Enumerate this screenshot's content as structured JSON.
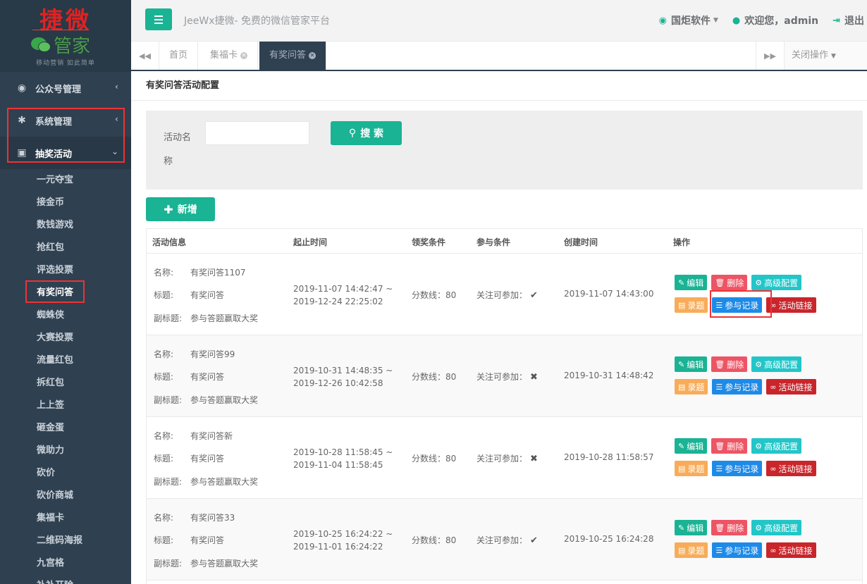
{
  "logo": {
    "main": "捷微",
    "sub": "管家",
    "slogan": "移动营销 如此简单"
  },
  "sidebar": {
    "groups": [
      {
        "label": "公众号管理"
      },
      {
        "label": "系统管理"
      },
      {
        "label": "抽奖活动"
      }
    ],
    "sub_items": [
      "一元夺宝",
      "接金币",
      "数钱游戏",
      "抢红包",
      "评选投票",
      "有奖问答",
      "蜘蛛侠",
      "大赛投票",
      "流量红包",
      "拆红包",
      "上上签",
      "砸金蛋",
      "微助力",
      "砍价",
      "砍价商城",
      "集福卡",
      "二维码海报",
      "九宫格",
      "补补开除"
    ]
  },
  "topbar": {
    "brand": "JeeWx捷微- 免费的微信管家平台",
    "software": "国炬软件",
    "welcome": "欢迎您，admin",
    "logout": "退出"
  },
  "tabs": {
    "items": [
      "首页",
      "集福卡",
      "有奖问答"
    ],
    "close_ops": "关闭操作"
  },
  "panel": {
    "title": "有奖问答活动配置"
  },
  "search": {
    "label": "活动名称",
    "value": "",
    "button": "搜 索"
  },
  "add_button": "新增",
  "table": {
    "headers": [
      "活动信息",
      "起止时间",
      "领奖条件",
      "参与条件",
      "创建时间",
      "操作"
    ],
    "info_labels": [
      "名称:",
      "标题:",
      "副标题:"
    ],
    "rows": [
      {
        "name": "有奖问答1107",
        "title": "有奖问答",
        "subtitle": "参与答题赢取大奖",
        "start": "2019-11-07 14:42:47 ~",
        "end": "2019-12-24 22:25:02",
        "award": "分数线：80",
        "join": "关注可参加：",
        "join_mark": "✔",
        "created": "2019-11-07 14:43:00"
      },
      {
        "name": "有奖问答99",
        "title": "有奖问答",
        "subtitle": "参与答题赢取大奖",
        "start": "2019-10-31 14:48:35 ~",
        "end": "2019-12-26 10:42:58",
        "award": "分数线：80",
        "join": "关注可参加：",
        "join_mark": "✖",
        "created": "2019-10-31 14:48:42"
      },
      {
        "name": "有奖问答新",
        "title": "有奖问答",
        "subtitle": "参与答题赢取大奖",
        "start": "2019-10-28 11:58:45 ~",
        "end": "2019-11-04 11:58:45",
        "award": "分数线：80",
        "join": "关注可参加：",
        "join_mark": "✖",
        "created": "2019-10-28 11:58:57"
      },
      {
        "name": "有奖问答33",
        "title": "有奖问答",
        "subtitle": "参与答题赢取大奖",
        "start": "2019-10-25 16:24:22 ~",
        "end": "2019-11-01 16:24:22",
        "award": "分数线：80",
        "join": "关注可参加：",
        "join_mark": "✔",
        "created": "2019-10-25 16:24:28"
      }
    ],
    "actions": {
      "edit": "编辑",
      "delete": "删除",
      "advanced": "高级配置",
      "record": "录题",
      "participants": "参与记录",
      "link": "活动链接"
    }
  },
  "colors": {
    "primary": "#1ab394",
    "sidebar": "#2f4050",
    "highlight": "#e33333"
  }
}
